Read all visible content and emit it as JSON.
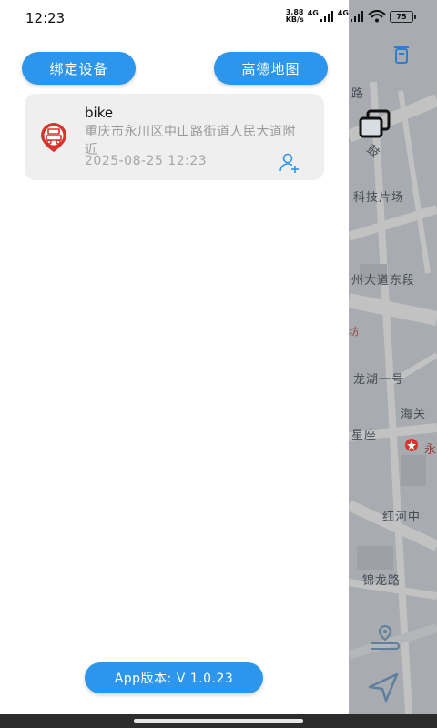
{
  "status_bar": {
    "time": "12:23",
    "net_speed_value": "3.88",
    "net_speed_unit": "KB/s",
    "network_1": "4G",
    "network_2": "4G",
    "battery": "75"
  },
  "drawer": {
    "bind_device_label": "绑定设备",
    "amap_label": "高德地图",
    "devices": [
      {
        "name": "bike",
        "address": "重庆市永川区中山路街道人民大道附近",
        "time": "2025-08-25 12:23"
      }
    ],
    "version_label": "App版本: V 1.0.23"
  },
  "map": {
    "labels": {
      "l1": "科技片场",
      "l2": "州大道东段",
      "l3": "龙湖一号",
      "l4": "海关",
      "l5": "星座",
      "l6": "红河中",
      "l7": "锦龙路",
      "l8": "永",
      "l9": "坊",
      "l10": "鼓",
      "l11": "路"
    }
  },
  "colors": {
    "primary": "#2b96ec",
    "device_marker": "#d9322c",
    "card_bg": "#efefef",
    "map_bg": "#d7dde3"
  }
}
